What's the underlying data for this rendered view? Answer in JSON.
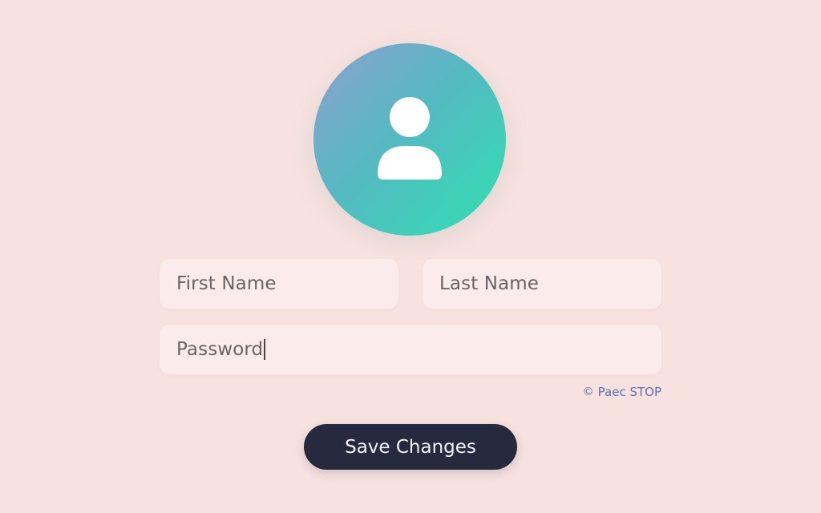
{
  "profile": {
    "avatar_icon": "user-silhouette-icon",
    "avatar_gradient": [
      "#8f9fcf",
      "#56b9c2",
      "#2fe0b1"
    ]
  },
  "form": {
    "first_name_placeholder": "First Name",
    "last_name_placeholder": "Last Name",
    "password_value": "Password",
    "note_icon": "copyright-circle-icon",
    "note_text": "Paec STOP"
  },
  "actions": {
    "save_label": "Save Changes",
    "save_color": "#272a3e"
  },
  "colors": {
    "background": "#f7e2df",
    "field": "#fbeceb",
    "note_text": "#5f6eb5"
  }
}
